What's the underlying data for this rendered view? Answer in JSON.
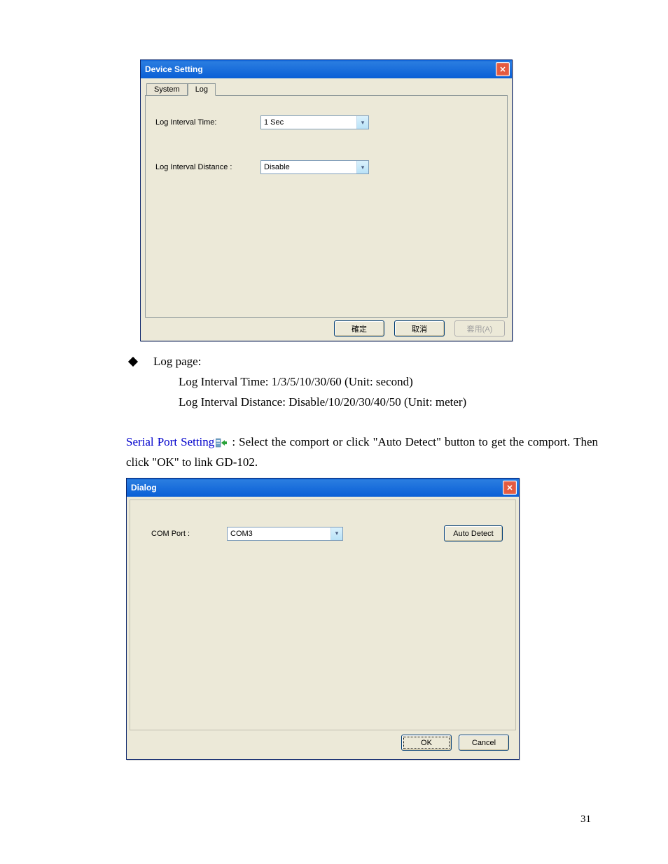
{
  "dialog1": {
    "title": "Device Setting",
    "tabs": {
      "system": "System",
      "log": "Log"
    },
    "fields": {
      "log_interval_time_label": "Log Interval Time:",
      "log_interval_time_value": "1 Sec",
      "log_interval_distance_label": "Log Interval Distance :",
      "log_interval_distance_value": "Disable"
    },
    "buttons": {
      "ok": "確定",
      "cancel": "取消",
      "apply": "套用(A)"
    }
  },
  "doc": {
    "bullet_label": "Log page:",
    "line1": "Log Interval Time: 1/3/5/10/30/60 (Unit: second)",
    "line2": "Log Interval Distance: Disable/10/20/30/40/50 (Unit: meter)",
    "serial_link": "Serial Port Setting",
    "serial_rest": " : Select the comport or click \"Auto Detect\" button to get the comport. Then click \"OK\" to link GD-102."
  },
  "dialog2": {
    "title": "Dialog",
    "comport_label": "COM Port :",
    "comport_value": "COM3",
    "autodetect": "Auto Detect",
    "ok": "OK",
    "cancel": "Cancel"
  },
  "page_number": "31"
}
